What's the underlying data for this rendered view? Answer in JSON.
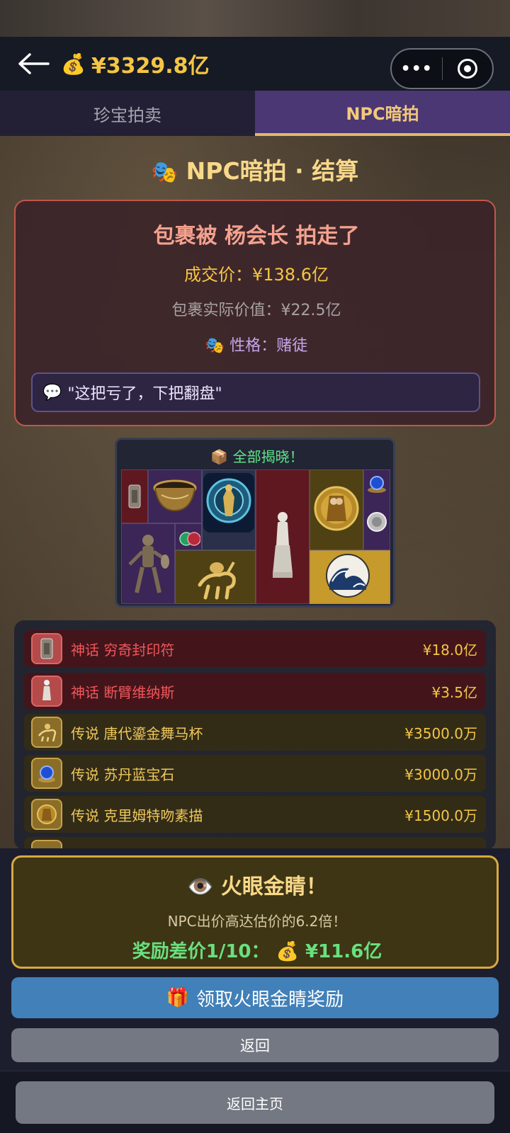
{
  "header": {
    "back_icon": "arrow-left-icon",
    "money_icon": "money-bag-icon",
    "balance": "¥3329.8亿",
    "more_label": "•••",
    "close_icon": "target-icon"
  },
  "tabs": [
    {
      "label": "珍宝拍卖",
      "active": false
    },
    {
      "label": "NPC暗拍",
      "active": true
    }
  ],
  "title": {
    "icon": "theater-masks-icon",
    "text": "NPC暗拍 · 结算"
  },
  "result": {
    "headline": "包裹被 杨会长 拍走了",
    "deal_price": "成交价：¥138.6亿",
    "actual_value": "包裹实际价值：¥22.5亿",
    "personality_icon": "theater-masks-icon",
    "personality": "性格：赌徒",
    "quote_icon": "speech-bubble-icon",
    "quote": "\"这把亏了，下把翻盘\""
  },
  "reveal": {
    "icon": "package-icon",
    "title": "全部揭晓！",
    "items": [
      "seal-talisman",
      "gilded-bowl",
      "buddha-statue",
      "venus-statue",
      "klimt-kiss-painting",
      "blue-gem",
      "silver-coin",
      "warrior-figure",
      "green-red-gem",
      "gilded-horse-cup",
      "great-wave-painting"
    ]
  },
  "items": [
    {
      "rarity": "神话",
      "name": "穷奇封印符",
      "price": "¥18.0亿",
      "tier": "myth",
      "icon": "talisman-icon"
    },
    {
      "rarity": "神话",
      "name": "断臂维纳斯",
      "price": "¥3.5亿",
      "tier": "myth",
      "icon": "statue-icon"
    },
    {
      "rarity": "传说",
      "name": "唐代鎏金舞马杯",
      "price": "¥3500.0万",
      "tier": "legend",
      "icon": "horse-cup-icon"
    },
    {
      "rarity": "传说",
      "name": "苏丹蓝宝石",
      "price": "¥3000.0万",
      "tier": "legend",
      "icon": "sapphire-icon"
    },
    {
      "rarity": "传说",
      "name": "克里姆特吻素描",
      "price": "¥1500.0万",
      "tier": "legend",
      "icon": "painting-icon"
    }
  ],
  "reward": {
    "icon": "eye-icon",
    "title": "火眼金睛！",
    "desc": "NPC出价高达估价的6.2倍！",
    "amount_label": "奖励差价1/10：",
    "amount_icon": "money-bag-icon",
    "amount": "¥11.6亿"
  },
  "buttons": {
    "claim_icon": "gift-icon",
    "claim": "领取火眼金睛奖励",
    "back": "返回",
    "home": "返回主页"
  }
}
